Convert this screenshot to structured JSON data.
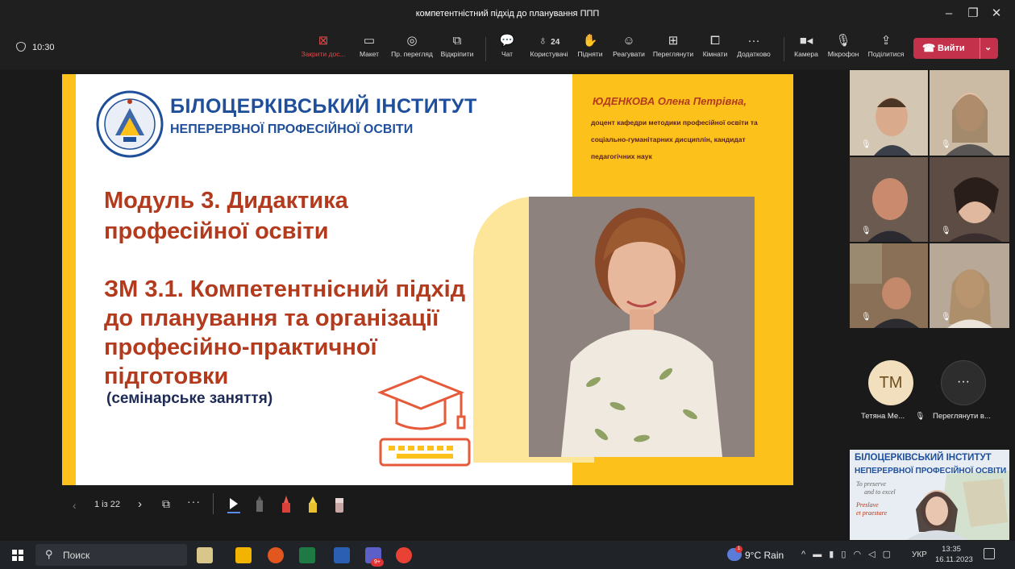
{
  "window": {
    "title": "компетентністний підхід до планування ППП"
  },
  "toolbar": {
    "timer": "10:30",
    "buttons": [
      {
        "label": "Закрити дос...",
        "icon": "close-share-icon"
      },
      {
        "label": "Макет",
        "icon": "layout-icon"
      },
      {
        "label": "Пр. перегляд",
        "icon": "preview-icon"
      },
      {
        "label": "Відкріпити",
        "icon": "pop-out-icon"
      },
      {
        "label": "Чат",
        "icon": "chat-icon"
      },
      {
        "label": "Користувачі",
        "icon": "people-icon",
        "count": "24"
      },
      {
        "label": "Підняти",
        "icon": "raise-hand-icon"
      },
      {
        "label": "Реагувати",
        "icon": "react-icon"
      },
      {
        "label": "Переглянути",
        "icon": "view-icon"
      },
      {
        "label": "Кімнати",
        "icon": "rooms-icon"
      },
      {
        "label": "Додатково",
        "icon": "more-icon"
      },
      {
        "label": "Камера",
        "icon": "camera-icon"
      },
      {
        "label": "Мікрофон",
        "icon": "microphone-icon"
      },
      {
        "label": "Поділитися",
        "icon": "share-icon"
      }
    ],
    "leave_label": "Вийти"
  },
  "slide": {
    "institute_line1": "БІЛОЦЕРКІВСЬКИЙ ІНСТИТУТ",
    "institute_line2": "НЕПЕРЕРВНОЇ ПРОФЕСІЙНОЇ ОСВІТИ",
    "module_title": "Модуль 3. Дидактика професійної освіти",
    "topic_title": "ЗМ 3.1. Компетентнісний підхід до планування та організації професійно-практичної підготовки",
    "topic_subtitle": "(семінарське заняття)",
    "author_name": "ЮДЕНКОВА Олена Петрівна,",
    "author_description": "доцент кафедри методики професійної освіти та соціально-гуманітарних дисциплін, кандидат педагогічних наук",
    "colors": {
      "accent": "#fcc21b",
      "title": "#b33a1d",
      "institute": "#1f4f9a"
    }
  },
  "slide_controls": {
    "page_indicator": "1 із 22"
  },
  "participants": {
    "avatar_initials": "ТМ",
    "avatar_name": "Тетяна Ме...",
    "more_label": "Переглянути в..."
  },
  "self_view": {
    "banner_line1": "БІЛОЦЕРКІВСЬКИЙ ІНСТИТУТ",
    "banner_line2": "НЕПЕРЕРВНОЇ ПРОФЕСІЙНОЇ ОСВІТИ",
    "motto1": "To preserve",
    "motto2": "and to excel",
    "motto3": "Preslave",
    "motto4": "et praestare"
  },
  "taskbar": {
    "search_placeholder": "Поиск",
    "weather": "9°C Rain",
    "weather_badge": "1",
    "app_badge": "9+",
    "language": "УКР",
    "time": "13:35",
    "date": "16.11.2023"
  }
}
